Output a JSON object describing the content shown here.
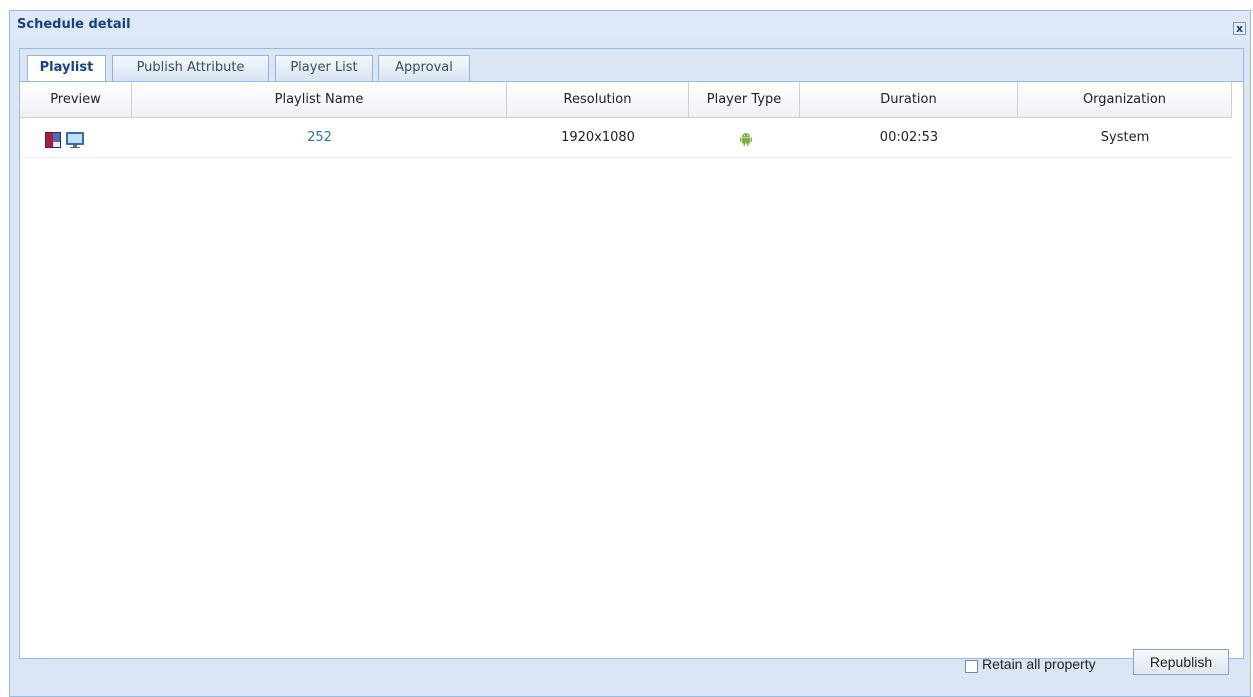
{
  "window": {
    "title": "Schedule detail",
    "close_label": "x"
  },
  "tabs": [
    {
      "label": "Playlist",
      "active": true
    },
    {
      "label": "Publish Attribute",
      "active": false
    },
    {
      "label": "Player List",
      "active": false
    },
    {
      "label": "Approval",
      "active": false
    }
  ],
  "grid": {
    "columns": [
      "Preview",
      "Playlist Name",
      "Resolution",
      "Player Type",
      "Duration",
      "Organization"
    ],
    "rows": [
      {
        "preview_icons": [
          "thumbnail-icon",
          "monitor-preview-icon"
        ],
        "playlist_name": "252",
        "resolution": "1920x1080",
        "player_type_icon": "android-icon",
        "duration": "00:02:53",
        "organization": "System"
      }
    ]
  },
  "footer": {
    "retain_label": "Retain all property",
    "retain_checked": false,
    "republish_label": "Republish"
  },
  "colors": {
    "accent": "#15428b",
    "link": "#2b71c9",
    "android": "#7cb342",
    "border": "#99bbe8"
  }
}
